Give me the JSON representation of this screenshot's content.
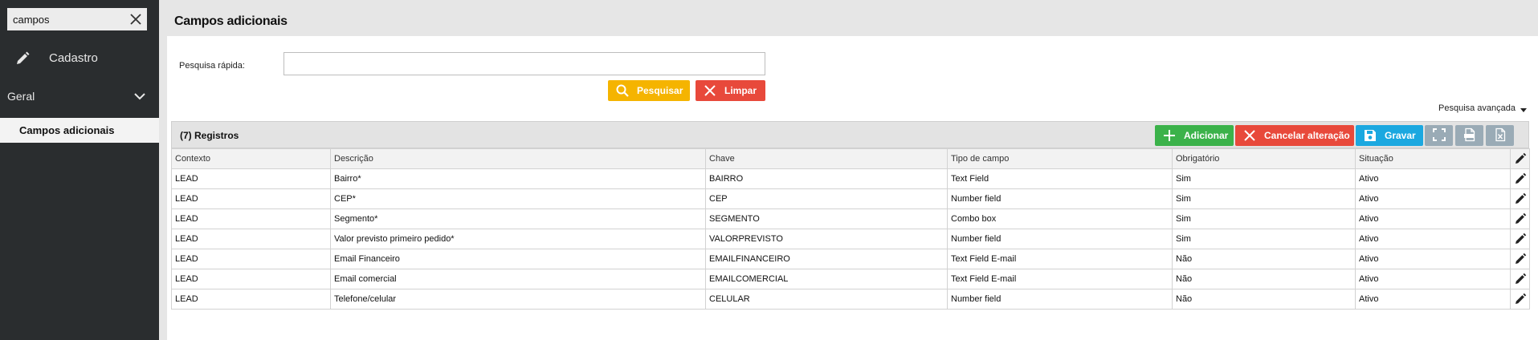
{
  "sidebar": {
    "search_value": "campos",
    "items": [
      {
        "label": "Cadastro"
      },
      {
        "label": "Geral"
      },
      {
        "label": "Campos adicionais"
      }
    ]
  },
  "page": {
    "title": "Campos adicionais"
  },
  "quick_search": {
    "label": "Pesquisa rápida:",
    "value": "",
    "search_label": "Pesquisar",
    "clear_label": "Limpar"
  },
  "advanced_search_label": "Pesquisa avançada",
  "grid": {
    "count_label": "(7) Registros",
    "add_label": "Adicionar",
    "cancel_label": "Cancelar alteração",
    "save_label": "Gravar",
    "columns": [
      "Contexto",
      "Descrição",
      "Chave",
      "Tipo de campo",
      "Obrigatório",
      "Situação"
    ],
    "rows": [
      [
        "LEAD",
        "Bairro*",
        "BAIRRO",
        "Text Field",
        "Sim",
        "Ativo"
      ],
      [
        "LEAD",
        "CEP*",
        "CEP",
        "Number field",
        "Sim",
        "Ativo"
      ],
      [
        "LEAD",
        "Segmento*",
        "SEGMENTO",
        "Combo box",
        "Sim",
        "Ativo"
      ],
      [
        "LEAD",
        "Valor previsto primeiro pedido*",
        "VALORPREVISTO",
        "Number field",
        "Sim",
        "Ativo"
      ],
      [
        "LEAD",
        "Email Financeiro",
        "EMAILFINANCEIRO",
        "Text Field E-mail",
        "Não",
        "Ativo"
      ],
      [
        "LEAD",
        "Email comercial",
        "EMAILCOMERCIAL",
        "Text Field E-mail",
        "Não",
        "Ativo"
      ],
      [
        "LEAD",
        "Telefone/celular",
        "CELULAR",
        "Number field",
        "Não",
        "Ativo"
      ]
    ]
  },
  "colors": {
    "sidebar": "#2a2d2f",
    "yellow": "#f5b400",
    "red": "#e8493b",
    "green": "#3bb24a",
    "blue": "#1ba8e0",
    "gray_button": "#9aabb6"
  },
  "icons": {
    "search_clear": "close-icon",
    "cadastro": "pencil-icon",
    "geral": "chevron-down-icon",
    "pesquisar": "search-icon",
    "limpar": "close-icon",
    "add": "plus-icon",
    "cancel": "close-icon",
    "save": "save-icon",
    "expand": "fullscreen-icon",
    "export_csv": "csv-export-icon",
    "export_xls": "xls-export-icon",
    "row_edit": "pencil-icon"
  }
}
